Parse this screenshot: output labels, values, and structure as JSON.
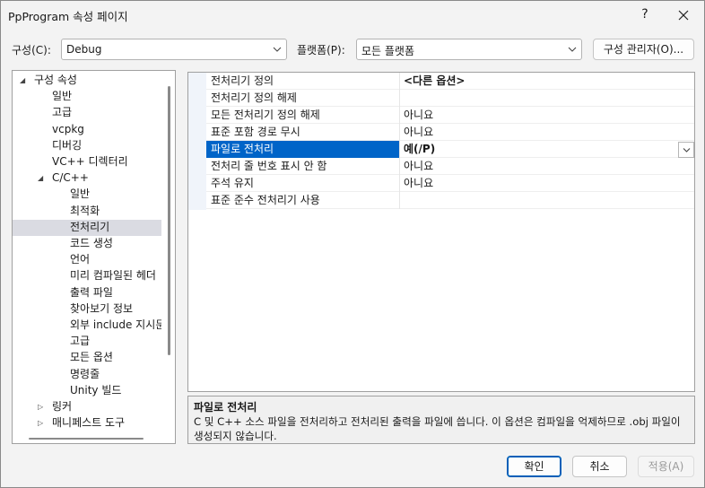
{
  "window": {
    "title": "PpProgram 속성 페이지",
    "help_label": "?"
  },
  "config": {
    "label": "구성(C):",
    "value": "Debug"
  },
  "platform": {
    "label": "플랫폼(P):",
    "value": "모든 플랫폼"
  },
  "config_manager_label": "구성 관리자(O)...",
  "tree": {
    "items": [
      {
        "label": "구성 속성",
        "caret": "◢"
      },
      {
        "label": "일반"
      },
      {
        "label": "고급"
      },
      {
        "label": "vcpkg"
      },
      {
        "label": "디버깅"
      },
      {
        "label": "VC++ 디렉터리"
      },
      {
        "label": "C/C++",
        "caret": "◢"
      },
      {
        "label": "일반"
      },
      {
        "label": "최적화"
      },
      {
        "label": "전처리기"
      },
      {
        "label": "코드 생성"
      },
      {
        "label": "언어"
      },
      {
        "label": "미리 컴파일된 헤더"
      },
      {
        "label": "출력 파일"
      },
      {
        "label": "찾아보기 정보"
      },
      {
        "label": "외부 include 지시문"
      },
      {
        "label": "고급"
      },
      {
        "label": "모든 옵션"
      },
      {
        "label": "명령줄"
      },
      {
        "label": "Unity 빌드"
      },
      {
        "label": "링커",
        "caret": "▷"
      },
      {
        "label": "매니페스트 도구",
        "caret": "▷"
      }
    ],
    "selected_index": 9
  },
  "properties": {
    "rows": [
      {
        "name": "전처리기 정의",
        "value": "<다른 옵션>"
      },
      {
        "name": "전처리기 정의 해제",
        "value": ""
      },
      {
        "name": "모든 전처리기 정의 해제",
        "value": "아니요"
      },
      {
        "name": "표준 포함 경로 무시",
        "value": "아니요"
      },
      {
        "name": "파일로 전처리",
        "value": "예(/P)"
      },
      {
        "name": "전처리 줄 번호 표시 안 함",
        "value": "아니요"
      },
      {
        "name": "주석 유지",
        "value": "아니요"
      },
      {
        "name": "표준 준수 전처리기 사용",
        "value": ""
      }
    ],
    "selected_index": 4
  },
  "description": {
    "title": "파일로 전처리",
    "text": "C 및 C++ 소스 파일을 전처리하고 전처리된 출력을 파일에 씁니다. 이 옵션은 컴파일을 억제하므로 .obj 파일이 생성되지 않습니다."
  },
  "buttons": {
    "ok": "확인",
    "cancel": "취소",
    "apply": "적용(A)"
  },
  "colors": {
    "selection_blue": "#0064c8",
    "tree_selection": "#dadbe2",
    "disabled_text": "#9a9a9a"
  }
}
